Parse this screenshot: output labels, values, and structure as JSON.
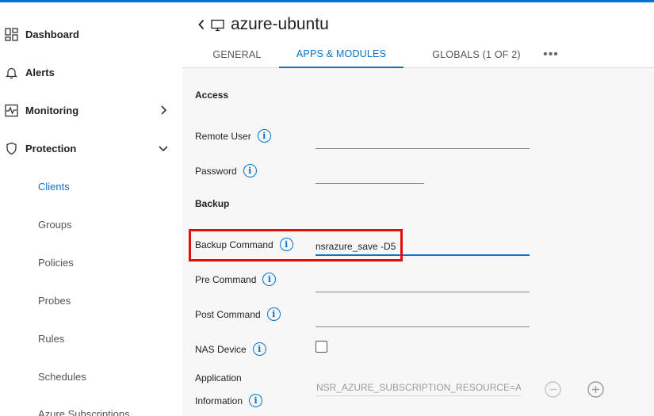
{
  "sidebar": {
    "items": [
      {
        "label": "Dashboard",
        "icon": "grid-icon"
      },
      {
        "label": "Alerts",
        "icon": "bell-icon"
      },
      {
        "label": "Monitoring",
        "icon": "activity-icon"
      },
      {
        "label": "Protection",
        "icon": "shield-icon"
      }
    ],
    "protection_sub": [
      {
        "label": "Clients",
        "active": true
      },
      {
        "label": "Groups"
      },
      {
        "label": "Policies"
      },
      {
        "label": "Probes"
      },
      {
        "label": "Rules"
      },
      {
        "label": "Schedules"
      },
      {
        "label": "Azure Subscriptions"
      }
    ]
  },
  "header": {
    "title": "azure-ubuntu",
    "tabs": [
      {
        "label": "GENERAL"
      },
      {
        "label": "APPS & MODULES",
        "active": true
      },
      {
        "label": "GLOBALS (1 OF 2)"
      },
      {
        "label": "•••"
      }
    ]
  },
  "form": {
    "access_section": "Access",
    "remote_user_label": "Remote User",
    "remote_user_value": "",
    "password_label": "Password",
    "password_value": "",
    "backup_section": "Backup",
    "backup_command_label": "Backup Command",
    "backup_command_value": "nsrazure_save -D5",
    "pre_command_label": "Pre Command",
    "pre_command_value": "",
    "post_command_label": "Post Command",
    "post_command_value": "",
    "nas_device_label": "NAS Device",
    "nas_device_checked": false,
    "app_info_label_1": "Application",
    "app_info_label_2": "Information",
    "app_info_value": "NSR_AZURE_SUBSCRIPTION_RESOURCE=Azure",
    "info_glyph": "i"
  },
  "colors": {
    "accent": "#0672cb",
    "highlight": "#e10d0d"
  }
}
